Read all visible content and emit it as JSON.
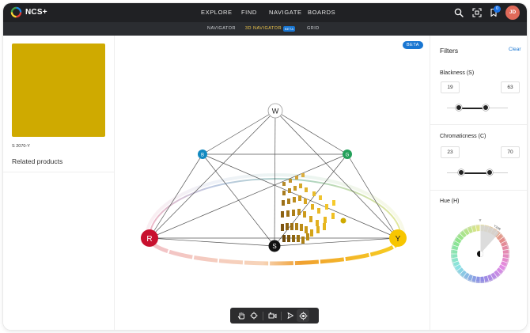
{
  "app": {
    "name": "NCS+"
  },
  "nav": {
    "explore": "EXPLORE",
    "find": "FIND",
    "navigate": "NAVIGATE",
    "boards": "BOARDS"
  },
  "header": {
    "bookmark_count": "0",
    "avatar_initials": "JD"
  },
  "subnav": {
    "navigator": "NAVIGATOR",
    "navigator_3d": "3D NAVIGATOR",
    "beta_mini": "BETA",
    "grid": "GRID"
  },
  "product": {
    "color": "#CFAA00",
    "code": "S 2070-Y"
  },
  "left": {
    "related_title": "Related products"
  },
  "viewer": {
    "beta_label": "BETA",
    "poles": {
      "white": "W",
      "black": "S",
      "red": "R",
      "yellow": "Y",
      "blue": "B",
      "green": "G"
    },
    "pole_colors": {
      "white": "#FFFFFF",
      "black": "#111111",
      "red": "#C8102E",
      "yellow": "#F7C600",
      "blue": "#1289C0",
      "green": "#24A05A"
    },
    "toolbar": [
      "hand-icon",
      "move-icon",
      "camera-icon",
      "pointer-icon",
      "target-icon"
    ]
  },
  "filters": {
    "title": "Filters",
    "clear": "Clear",
    "blackness": {
      "label": "Blackness (S)",
      "min": "19",
      "max": "63",
      "range": [
        0,
        100
      ],
      "low": 19,
      "high": 63
    },
    "chromaticness": {
      "label": "Chromaticness (C)",
      "min": "23",
      "max": "70",
      "range": [
        0,
        100
      ],
      "low": 23,
      "high": 70
    },
    "hue": {
      "label": "Hue (H)",
      "top_label": "Y",
      "selected_label": "Y10R"
    }
  },
  "colors": {
    "accent": "#1976D2",
    "topbar": "#202124",
    "subbar": "#2B2D31",
    "active_tab": "#F2C94C",
    "avatar": "#E06A5A"
  }
}
